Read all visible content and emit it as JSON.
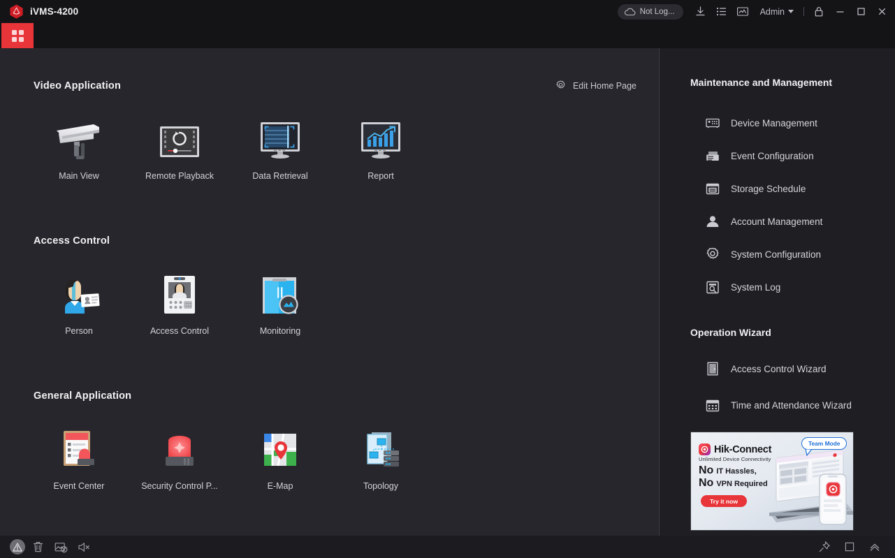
{
  "window": {
    "app_title": "iVMS-4200",
    "logo_icon": "hikvision-logo-icon",
    "controls": {
      "cloud_status": "Not Log...",
      "cloud_icon": "cloud-icon",
      "download_icon": "download-icon",
      "tasklist_icon": "task-list-icon",
      "monitor_icon": "device-status-icon",
      "user_name": "Admin",
      "user_caret_icon": "chevron-down-icon",
      "lock_icon": "lock-icon",
      "minimize_icon": "minimize-icon",
      "maximize_icon": "maximize-icon",
      "close_icon": "close-icon"
    }
  },
  "tabs": [
    {
      "label": "",
      "icon": "home-grid-icon",
      "active": true
    }
  ],
  "main": {
    "edit_home": {
      "label": "Edit Home Page",
      "icon": "gear-icon"
    },
    "sections": [
      {
        "title": "Video Application",
        "items": [
          {
            "label": "Main View",
            "icon": "camera-icon"
          },
          {
            "label": "Remote Playback",
            "icon": "playback-monitor-icon"
          },
          {
            "label": "Data Retrieval",
            "icon": "data-retrieval-monitor-icon"
          },
          {
            "label": "Report",
            "icon": "report-chart-monitor-icon"
          }
        ]
      },
      {
        "title": "Access Control",
        "items": [
          {
            "label": "Person",
            "icon": "person-card-icon"
          },
          {
            "label": "Access Control",
            "icon": "access-terminal-icon"
          },
          {
            "label": "Monitoring",
            "icon": "door-monitoring-icon"
          }
        ]
      },
      {
        "title": "General Application",
        "items": [
          {
            "label": "Event Center",
            "icon": "event-clipboard-icon"
          },
          {
            "label": "Security Control P...",
            "icon": "alarm-siren-icon"
          },
          {
            "label": "E-Map",
            "icon": "map-pin-icon"
          },
          {
            "label": "Topology",
            "icon": "topology-icon"
          }
        ]
      }
    ]
  },
  "right_panel": {
    "maintenance": {
      "title": "Maintenance and Management",
      "items": [
        {
          "label": "Device Management",
          "icon": "device-box-icon"
        },
        {
          "label": "Event Configuration",
          "icon": "event-config-icon"
        },
        {
          "label": "Storage Schedule",
          "icon": "storage-schedule-icon"
        },
        {
          "label": "Account Management",
          "icon": "user-account-icon"
        },
        {
          "label": "System Configuration",
          "icon": "gear-icon"
        },
        {
          "label": "System Log",
          "icon": "log-search-icon"
        }
      ]
    },
    "wizard": {
      "title": "Operation Wizard",
      "items": [
        {
          "label": "Access Control Wizard",
          "icon": "door-icon"
        },
        {
          "label": "Time and Attendance Wizard",
          "icon": "calendar-icon"
        }
      ]
    },
    "banner": {
      "brand": "Hik-Connect",
      "tagline": "Unlimited Device Connectivity",
      "line1_strong": "No",
      "line1_rest": "IT Hassles,",
      "line2_strong": "No",
      "line2_rest": "VPN Required",
      "cta": "Try it now",
      "badge": "Team Mode",
      "brand_color": "#e8353a"
    }
  },
  "status_bar": {
    "left": [
      {
        "icon": "alarm-warning-icon"
      },
      {
        "icon": "trash-icon"
      },
      {
        "icon": "picture-disabled-icon"
      },
      {
        "icon": "mute-icon"
      }
    ],
    "right": [
      {
        "icon": "pin-icon"
      },
      {
        "icon": "panel-icon"
      },
      {
        "icon": "collapse-up-icon"
      }
    ]
  },
  "theme": {
    "accent_red": "#e8353a",
    "main_bg": "#26262c",
    "panel_bg": "#1e1e23",
    "titlebar_bg": "#141417",
    "text_primary": "#f2f2f4",
    "text_secondary": "#d3d3d8"
  }
}
